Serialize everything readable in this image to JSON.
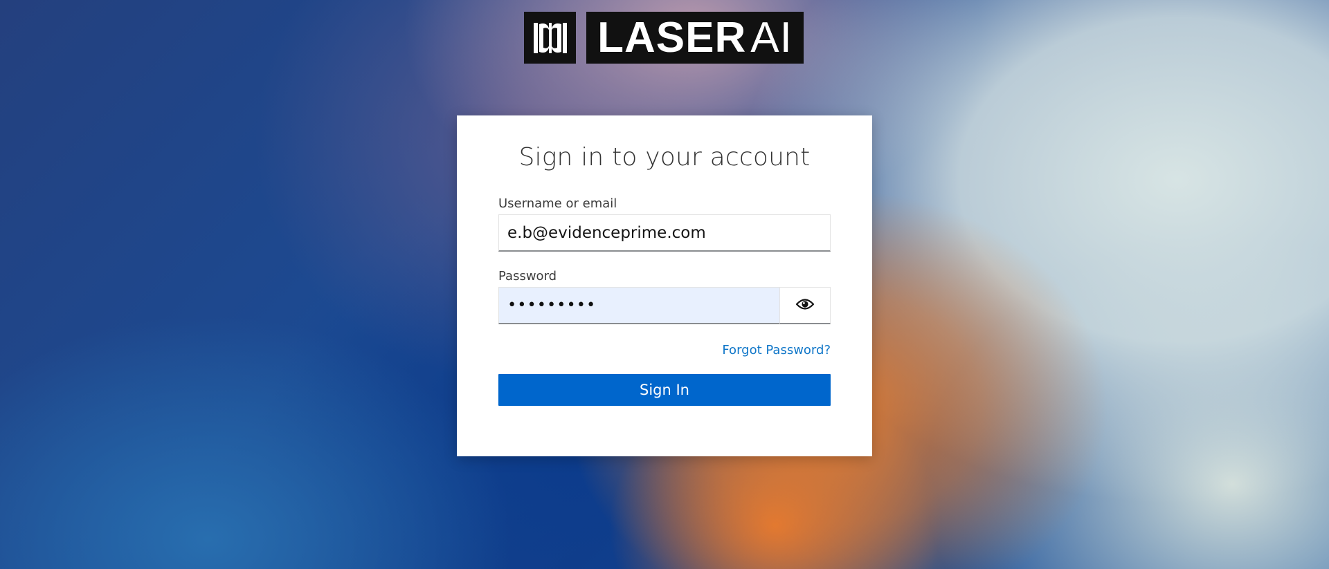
{
  "brand": {
    "logo_text_bold": "LASER",
    "logo_text_light": "AI",
    "mark_icon": "laserai-mark-icon"
  },
  "login": {
    "title": "Sign in to your account",
    "username_label": "Username or email",
    "username_value": "e.b@evidenceprime.com",
    "password_label": "Password",
    "password_value": "•••••••••",
    "show_password_icon": "eye-icon",
    "forgot_password": "Forgot Password?",
    "submit_label": "Sign In"
  },
  "colors": {
    "primary": "#0066cc",
    "link": "#0f76c8",
    "autofill_bg": "#e8f0fe"
  }
}
